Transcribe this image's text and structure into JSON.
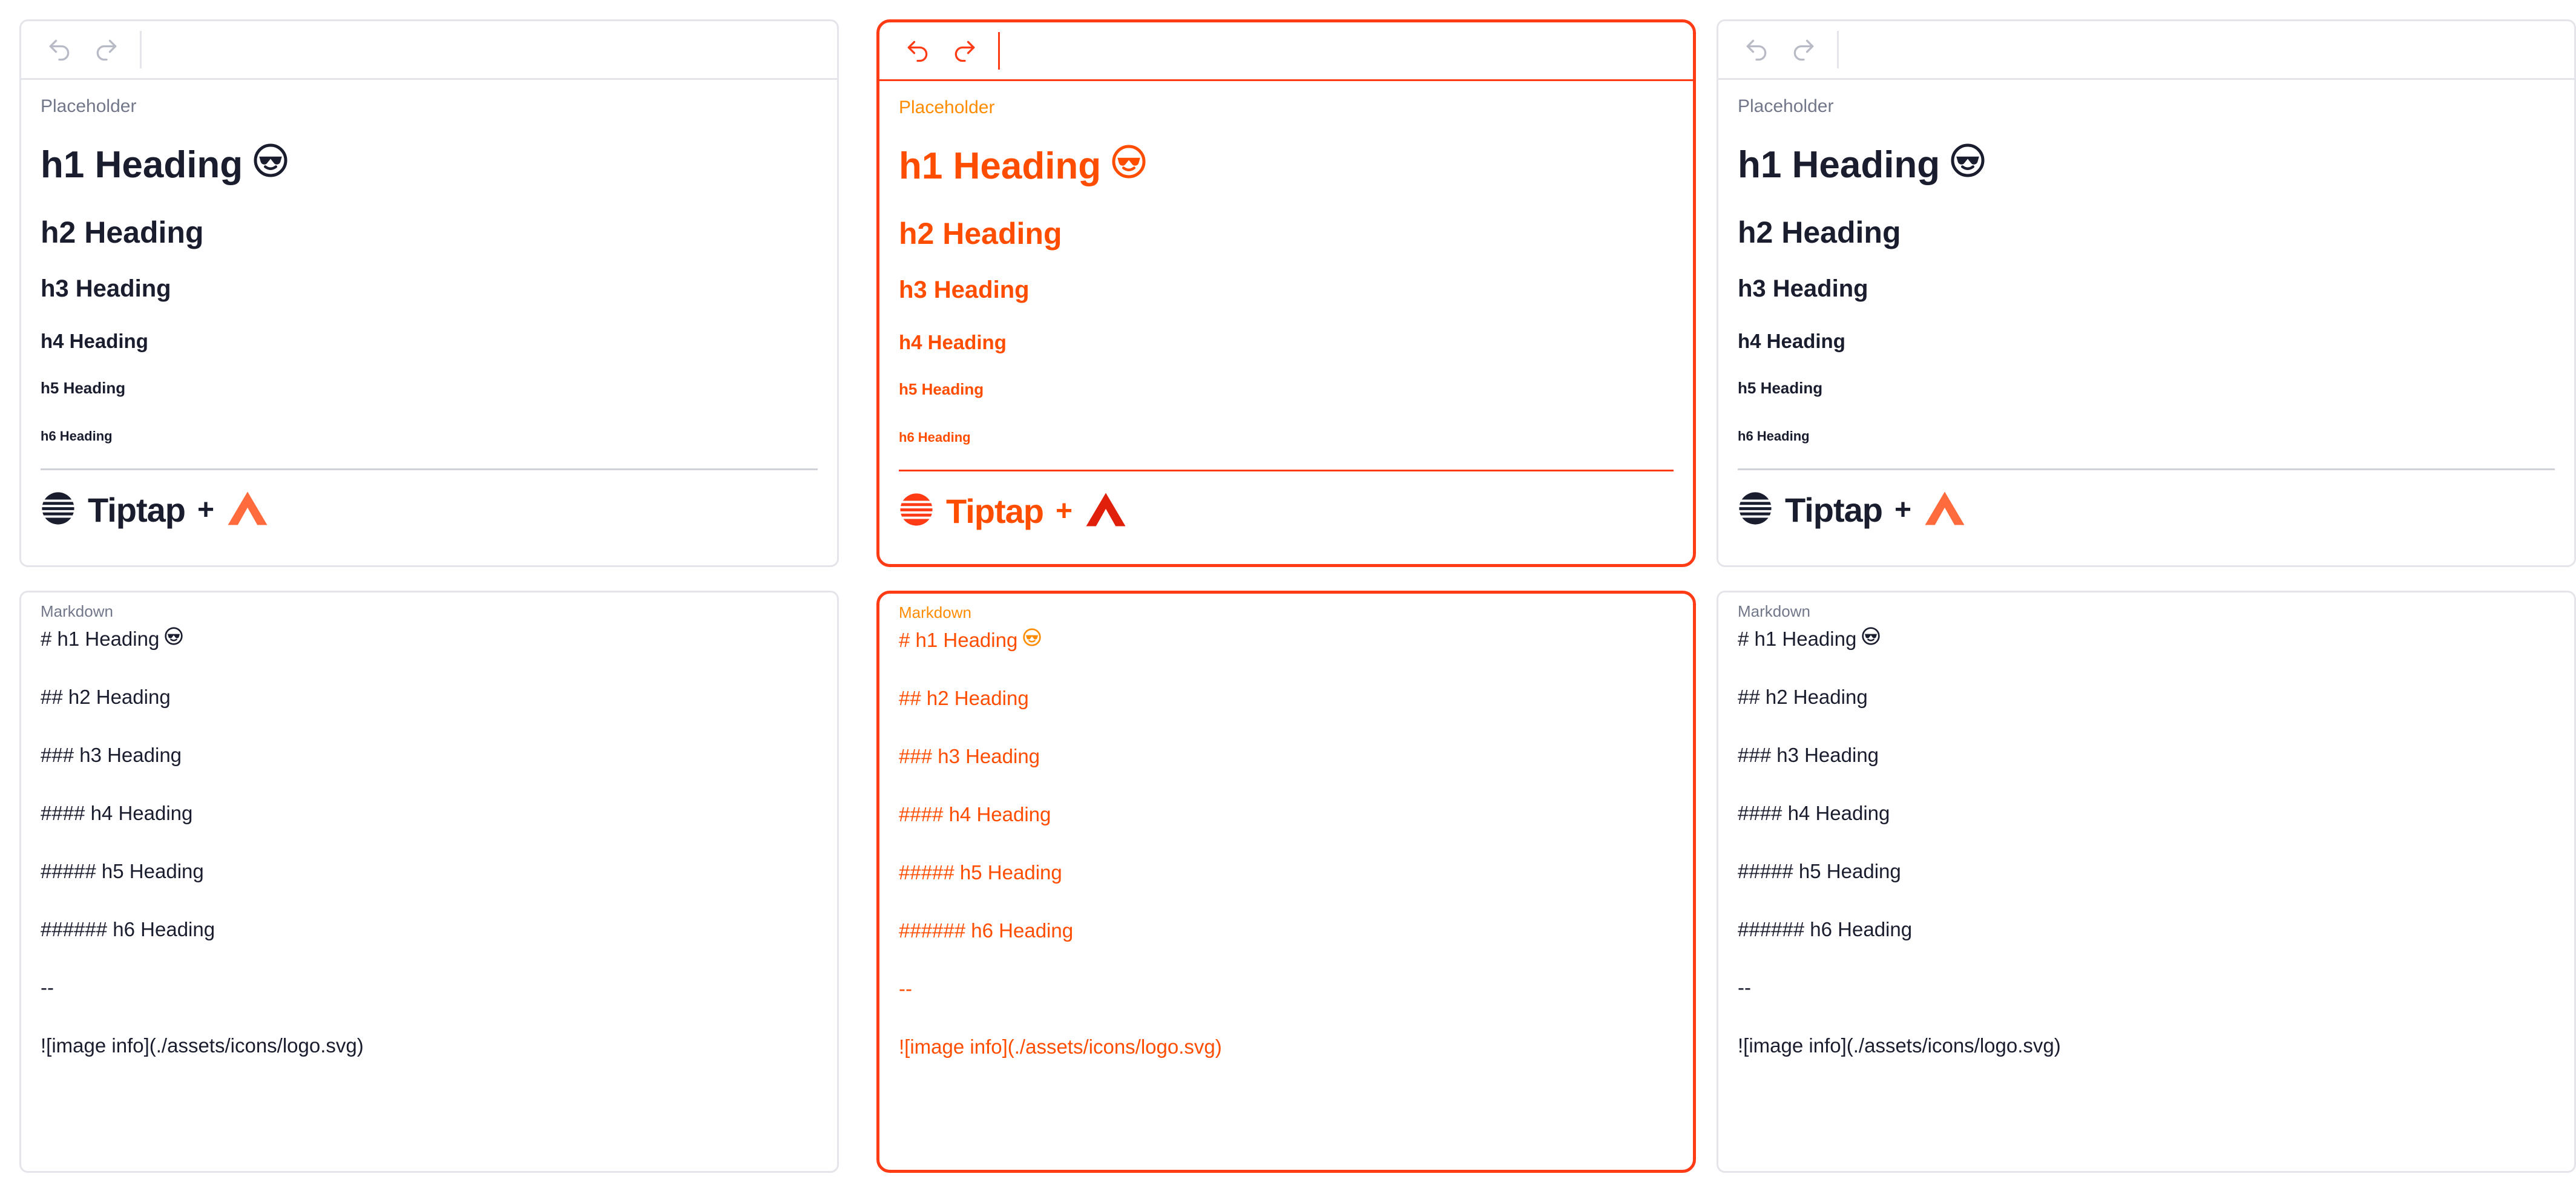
{
  "toolbar": {
    "undo_icon": "undo-icon",
    "redo_icon": "redo-icon"
  },
  "editor": {
    "placeholder_label": "Placeholder",
    "h1": "h1 Heading",
    "h2": "h2 Heading",
    "h3": "h3 Heading",
    "h4": "h4 Heading",
    "h5": "h5 Heading",
    "h6": "h6 Heading",
    "brand": "Tiptap",
    "plus": "+"
  },
  "markdown": {
    "label": "Markdown",
    "lines": [
      "# h1 Heading",
      "## h2 Heading",
      "### h3 Heading",
      "#### h4 Heading",
      "##### h5 Heading",
      "###### h6 Heading",
      "--",
      "![image info](./assets/icons/logo.svg)"
    ]
  },
  "colors": {
    "text": "#1a1d2e",
    "muted": "#727789",
    "border": "#e4e5ea",
    "diff_red": "#ff3b16",
    "diff_orange": "#ff4d00",
    "accent_logo": "#ff6b3d"
  }
}
